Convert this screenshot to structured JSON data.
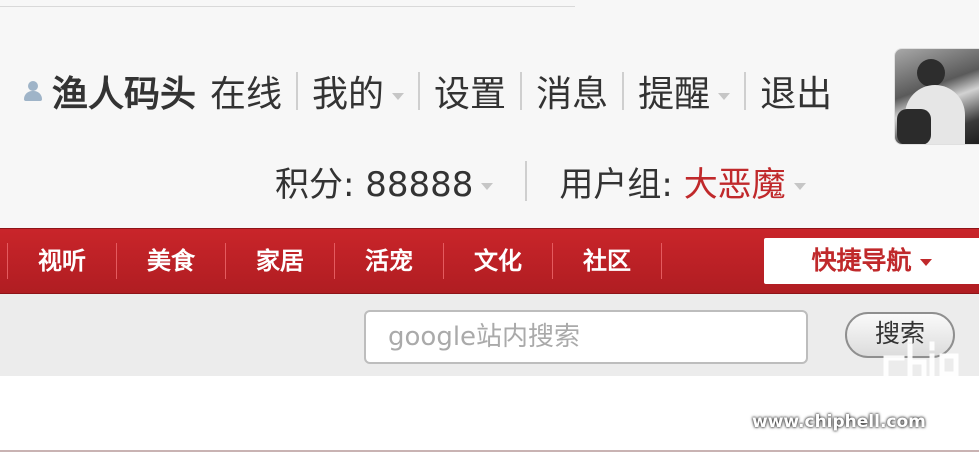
{
  "user": {
    "username": "渔人码头",
    "status": "在线",
    "links": [
      "我的",
      "设置",
      "消息",
      "提醒",
      "退出"
    ]
  },
  "stats": {
    "points_label": "积分: 88888",
    "group_label": "用户组: ",
    "group_name": "大恶魔"
  },
  "nav": {
    "items": [
      "视听",
      "美食",
      "家居",
      "活宠",
      "文化",
      "社区"
    ],
    "quick_nav": "快捷导航"
  },
  "search": {
    "placeholder": "google站内搜索",
    "button": "搜索"
  },
  "watermark": {
    "url": "www.chiphell.com"
  },
  "colors": {
    "brand_red": "#c0292b",
    "nav_bg": "#b81f24"
  }
}
